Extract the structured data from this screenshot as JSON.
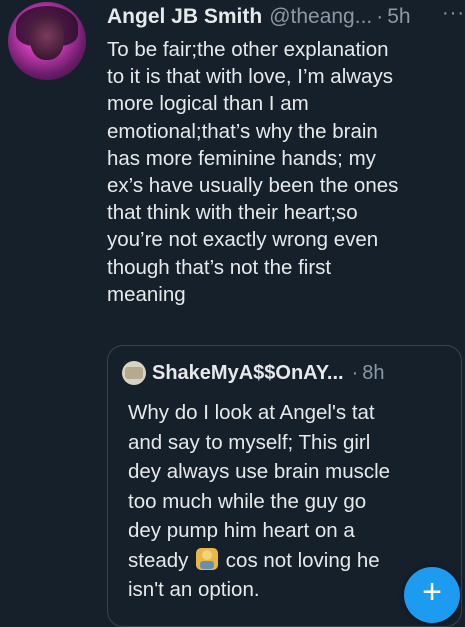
{
  "tweet": {
    "author_name": "Angel JB Smith",
    "handle": "@theang...",
    "separator": "·",
    "time": "5h",
    "more_glyph": "···",
    "text_lines": [
      "To be fair;the other explanation",
      "to it is that with love, I’m always",
      "more logical than I am",
      "emotional;that’s why the brain",
      "has more feminine hands; my",
      "ex’s have usually been the ones",
      "that think with their heart;so",
      "you’re not exactly wrong even",
      "though that’s not the first",
      "meaning"
    ]
  },
  "quoted": {
    "author_name": "ShakeMyA$$OnAY...",
    "separator": "·",
    "time": "8h",
    "lines": [
      "Why do I look at Angel's tat",
      "and say to myself; This girl",
      "dey always use brain muscle",
      "too much while the guy go",
      "dey pump him heart on a"
    ],
    "line6_before": "steady ",
    "line6_after": " cos not loving he",
    "line7": "isn't an option.",
    "emoji_icon": "person-shrugging-icon"
  },
  "fab": {
    "label": "+"
  },
  "colors": {
    "background": "#15202b",
    "accent": "#1d9bf0",
    "secondary_text": "#8b98a5",
    "border": "#38444d"
  }
}
